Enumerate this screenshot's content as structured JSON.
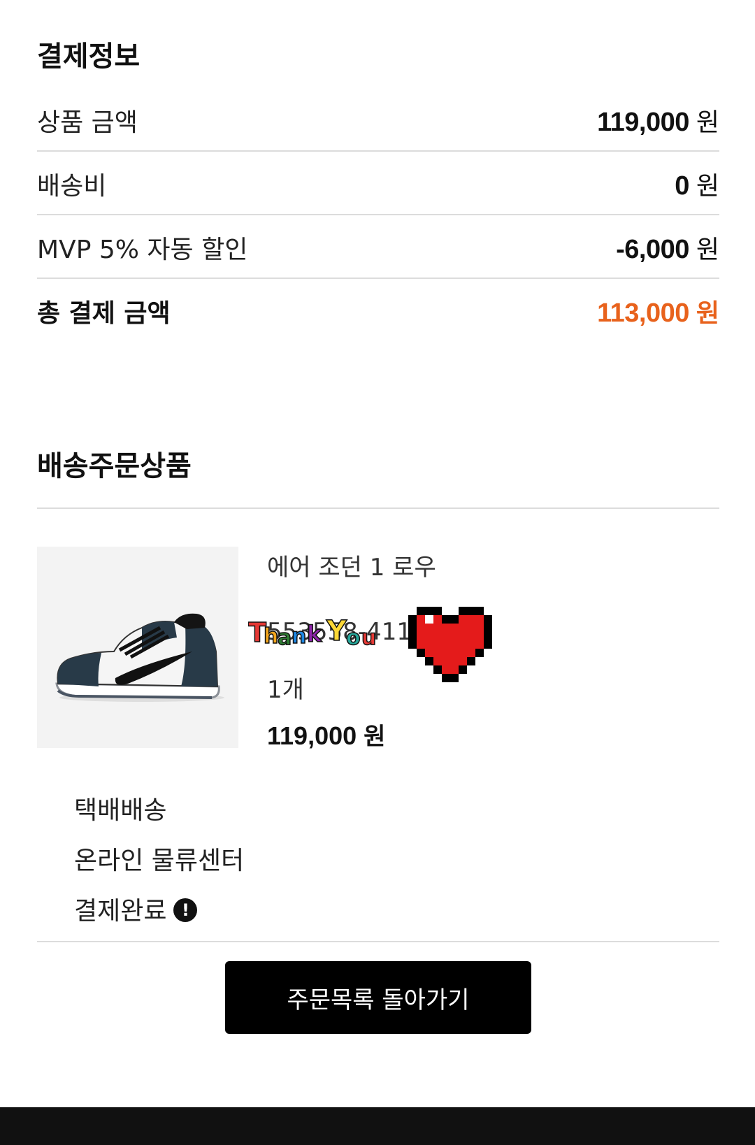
{
  "payment": {
    "title": "결제정보",
    "rows": [
      {
        "label": "상품 금액",
        "amount": "119,000",
        "unit": "원"
      },
      {
        "label": "배송비",
        "amount": "0",
        "unit": "원"
      },
      {
        "label": "MVP 5% 자동 할인",
        "amount": "-6,000",
        "unit": "원"
      }
    ],
    "total": {
      "label": "총 결제 금액",
      "amount": "113,000",
      "unit": "원"
    },
    "accent_color": "#e8621c"
  },
  "order": {
    "title": "배송주문상품",
    "product": {
      "name": "에어 조던 1 로우",
      "code": "553558-411",
      "quantity": "1개",
      "price": "119,000",
      "unit": "원",
      "image_icon": "sneaker-image"
    },
    "delivery_method": "택배배송",
    "warehouse": "온라인 물류센터",
    "status": "결제완료",
    "status_icon": "exclamation-circle-icon"
  },
  "actions": {
    "back_label": "주문목록 돌아가기"
  },
  "stickers": {
    "thanks_text": "ThankYou",
    "heart_icon": "pixel-heart-icon"
  }
}
